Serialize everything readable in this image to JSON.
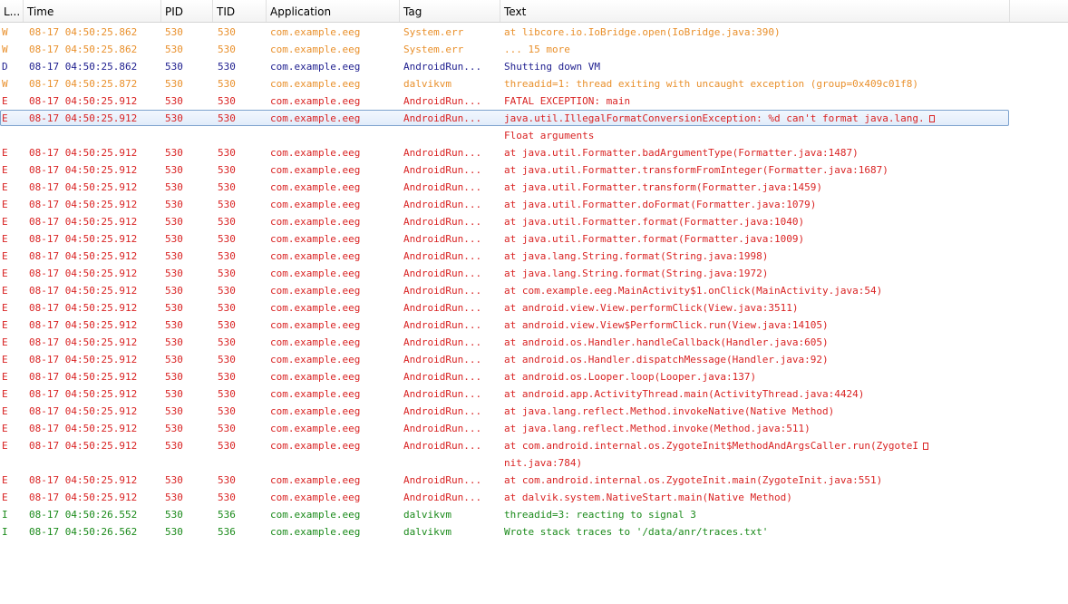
{
  "colors": {
    "warn": "#e9902c",
    "debug": "#1d1d8e",
    "error": "#d92323",
    "info": "#1a8a1a",
    "selection_border": "#7da2ce"
  },
  "columns": {
    "level": "L...",
    "time": "Time",
    "pid": "PID",
    "tid": "TID",
    "application": "Application",
    "tag": "Tag",
    "text": "Text"
  },
  "rows": [
    {
      "level": "W",
      "time": "08-17 04:50:25.862",
      "pid": "530",
      "tid": "530",
      "app": "com.example.eeg",
      "tag": "System.err",
      "text": "at libcore.io.IoBridge.open(IoBridge.java:390)"
    },
    {
      "level": "W",
      "time": "08-17 04:50:25.862",
      "pid": "530",
      "tid": "530",
      "app": "com.example.eeg",
      "tag": "System.err",
      "text": "... 15 more"
    },
    {
      "level": "D",
      "time": "08-17 04:50:25.862",
      "pid": "530",
      "tid": "530",
      "app": "com.example.eeg",
      "tag": "AndroidRun...",
      "text": "Shutting down VM"
    },
    {
      "level": "W",
      "time": "08-17 04:50:25.872",
      "pid": "530",
      "tid": "530",
      "app": "com.example.eeg",
      "tag": "dalvikvm",
      "text": "threadid=1: thread exiting with uncaught exception (group=0x409c01f8)"
    },
    {
      "level": "E",
      "time": "08-17 04:50:25.912",
      "pid": "530",
      "tid": "530",
      "app": "com.example.eeg",
      "tag": "AndroidRun...",
      "text": "FATAL EXCEPTION: main"
    },
    {
      "level": "E",
      "time": "08-17 04:50:25.912",
      "pid": "530",
      "tid": "530",
      "app": "com.example.eeg",
      "tag": "AndroidRun...",
      "text": "java.util.IllegalFormatConversionException: %d can't format java.lang.",
      "wrapped": true,
      "selected": true
    },
    {
      "level": "",
      "time": "",
      "pid": "",
      "tid": "",
      "app": "",
      "tag": "",
      "text": "Float arguments",
      "continuation": true,
      "color_level": "E"
    },
    {
      "level": "E",
      "time": "08-17 04:50:25.912",
      "pid": "530",
      "tid": "530",
      "app": "com.example.eeg",
      "tag": "AndroidRun...",
      "text": "at java.util.Formatter.badArgumentType(Formatter.java:1487)"
    },
    {
      "level": "E",
      "time": "08-17 04:50:25.912",
      "pid": "530",
      "tid": "530",
      "app": "com.example.eeg",
      "tag": "AndroidRun...",
      "text": "at java.util.Formatter.transformFromInteger(Formatter.java:1687)"
    },
    {
      "level": "E",
      "time": "08-17 04:50:25.912",
      "pid": "530",
      "tid": "530",
      "app": "com.example.eeg",
      "tag": "AndroidRun...",
      "text": "at java.util.Formatter.transform(Formatter.java:1459)"
    },
    {
      "level": "E",
      "time": "08-17 04:50:25.912",
      "pid": "530",
      "tid": "530",
      "app": "com.example.eeg",
      "tag": "AndroidRun...",
      "text": "at java.util.Formatter.doFormat(Formatter.java:1079)"
    },
    {
      "level": "E",
      "time": "08-17 04:50:25.912",
      "pid": "530",
      "tid": "530",
      "app": "com.example.eeg",
      "tag": "AndroidRun...",
      "text": "at java.util.Formatter.format(Formatter.java:1040)"
    },
    {
      "level": "E",
      "time": "08-17 04:50:25.912",
      "pid": "530",
      "tid": "530",
      "app": "com.example.eeg",
      "tag": "AndroidRun...",
      "text": "at java.util.Formatter.format(Formatter.java:1009)"
    },
    {
      "level": "E",
      "time": "08-17 04:50:25.912",
      "pid": "530",
      "tid": "530",
      "app": "com.example.eeg",
      "tag": "AndroidRun...",
      "text": "at java.lang.String.format(String.java:1998)"
    },
    {
      "level": "E",
      "time": "08-17 04:50:25.912",
      "pid": "530",
      "tid": "530",
      "app": "com.example.eeg",
      "tag": "AndroidRun...",
      "text": "at java.lang.String.format(String.java:1972)"
    },
    {
      "level": "E",
      "time": "08-17 04:50:25.912",
      "pid": "530",
      "tid": "530",
      "app": "com.example.eeg",
      "tag": "AndroidRun...",
      "text": "at com.example.eeg.MainActivity$1.onClick(MainActivity.java:54)"
    },
    {
      "level": "E",
      "time": "08-17 04:50:25.912",
      "pid": "530",
      "tid": "530",
      "app": "com.example.eeg",
      "tag": "AndroidRun...",
      "text": "at android.view.View.performClick(View.java:3511)"
    },
    {
      "level": "E",
      "time": "08-17 04:50:25.912",
      "pid": "530",
      "tid": "530",
      "app": "com.example.eeg",
      "tag": "AndroidRun...",
      "text": "at android.view.View$PerformClick.run(View.java:14105)"
    },
    {
      "level": "E",
      "time": "08-17 04:50:25.912",
      "pid": "530",
      "tid": "530",
      "app": "com.example.eeg",
      "tag": "AndroidRun...",
      "text": "at android.os.Handler.handleCallback(Handler.java:605)"
    },
    {
      "level": "E",
      "time": "08-17 04:50:25.912",
      "pid": "530",
      "tid": "530",
      "app": "com.example.eeg",
      "tag": "AndroidRun...",
      "text": "at android.os.Handler.dispatchMessage(Handler.java:92)"
    },
    {
      "level": "E",
      "time": "08-17 04:50:25.912",
      "pid": "530",
      "tid": "530",
      "app": "com.example.eeg",
      "tag": "AndroidRun...",
      "text": "at android.os.Looper.loop(Looper.java:137)"
    },
    {
      "level": "E",
      "time": "08-17 04:50:25.912",
      "pid": "530",
      "tid": "530",
      "app": "com.example.eeg",
      "tag": "AndroidRun...",
      "text": "at android.app.ActivityThread.main(ActivityThread.java:4424)"
    },
    {
      "level": "E",
      "time": "08-17 04:50:25.912",
      "pid": "530",
      "tid": "530",
      "app": "com.example.eeg",
      "tag": "AndroidRun...",
      "text": "at java.lang.reflect.Method.invokeNative(Native Method)"
    },
    {
      "level": "E",
      "time": "08-17 04:50:25.912",
      "pid": "530",
      "tid": "530",
      "app": "com.example.eeg",
      "tag": "AndroidRun...",
      "text": "at java.lang.reflect.Method.invoke(Method.java:511)"
    },
    {
      "level": "E",
      "time": "08-17 04:50:25.912",
      "pid": "530",
      "tid": "530",
      "app": "com.example.eeg",
      "tag": "AndroidRun...",
      "text": "at com.android.internal.os.ZygoteInit$MethodAndArgsCaller.run(ZygoteI",
      "wrapped": true
    },
    {
      "level": "",
      "time": "",
      "pid": "",
      "tid": "",
      "app": "",
      "tag": "",
      "text": "nit.java:784)",
      "continuation": true,
      "color_level": "E"
    },
    {
      "level": "E",
      "time": "08-17 04:50:25.912",
      "pid": "530",
      "tid": "530",
      "app": "com.example.eeg",
      "tag": "AndroidRun...",
      "text": "at com.android.internal.os.ZygoteInit.main(ZygoteInit.java:551)"
    },
    {
      "level": "E",
      "time": "08-17 04:50:25.912",
      "pid": "530",
      "tid": "530",
      "app": "com.example.eeg",
      "tag": "AndroidRun...",
      "text": "at dalvik.system.NativeStart.main(Native Method)"
    },
    {
      "level": "I",
      "time": "08-17 04:50:26.552",
      "pid": "530",
      "tid": "536",
      "app": "com.example.eeg",
      "tag": "dalvikvm",
      "text": "threadid=3: reacting to signal 3"
    },
    {
      "level": "I",
      "time": "08-17 04:50:26.562",
      "pid": "530",
      "tid": "536",
      "app": "com.example.eeg",
      "tag": "dalvikvm",
      "text": "Wrote stack traces to '/data/anr/traces.txt'"
    }
  ]
}
